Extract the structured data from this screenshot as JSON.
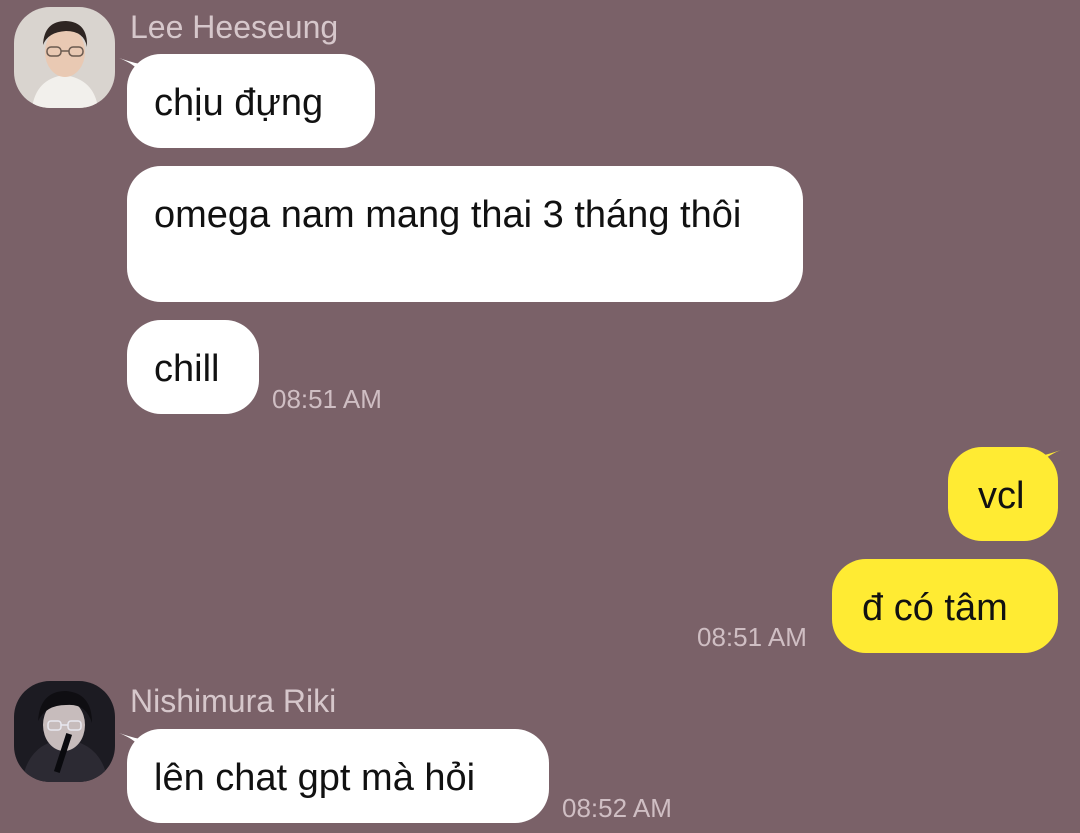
{
  "colors": {
    "background": "#7a6168",
    "incoming_bubble": "#ffffff",
    "outgoing_bubble": "#ffeb33",
    "sender_name": "#d6c7cb",
    "timestamp": "#cfbec3"
  },
  "chat": {
    "group_1": {
      "sender": "Lee Heeseung",
      "messages": [
        "chịu đựng",
        "omega nam mang thai 3 tháng thôi",
        "chill"
      ],
      "time": "08:51 AM"
    },
    "group_2": {
      "sender": "me",
      "messages": [
        "vcl",
        "đ có tâm"
      ],
      "time": "08:51 AM"
    },
    "group_3": {
      "sender": "Nishimura Riki",
      "messages": [
        "lên chat gpt mà hỏi"
      ],
      "time": "08:52 AM"
    }
  }
}
